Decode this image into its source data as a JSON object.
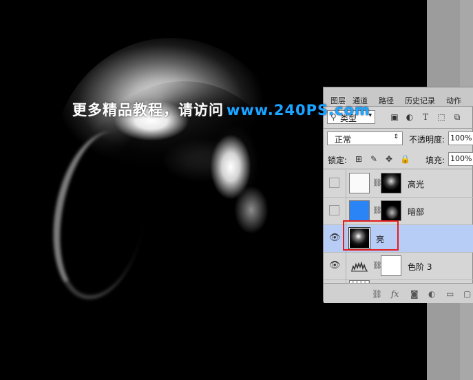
{
  "watermark": {
    "cn": "更多精品教程，请访问",
    "url": "www.240PS.com"
  },
  "panel": {
    "tabs": [
      {
        "label": "图层",
        "active": true
      },
      {
        "label": "通道",
        "active": false
      },
      {
        "label": "路径",
        "active": false
      },
      {
        "label": "历史记录",
        "active": false
      },
      {
        "label": "动作",
        "active": false
      }
    ],
    "filter": {
      "label": "类型",
      "icons": [
        "image-filter-icon",
        "adjustment-filter-icon",
        "type-filter-icon",
        "shape-filter-icon",
        "smart-object-filter-icon"
      ]
    },
    "blend_mode": "正常",
    "opacity_label": "不透明度:",
    "opacity_value": "100%",
    "lock_label": "锁定:",
    "fill_label": "填充:",
    "fill_value": "100%",
    "layers": [
      {
        "name": "高光",
        "visible": false,
        "selected": false
      },
      {
        "name": "暗部",
        "visible": false,
        "selected": false
      },
      {
        "name": "亮",
        "visible": true,
        "selected": true
      },
      {
        "name": "色阶 3",
        "visible": true,
        "selected": false
      }
    ],
    "bottom_icons": [
      "link-icon",
      "fx-icon",
      "mask-icon",
      "adjustment-icon",
      "folder-icon",
      "new-layer-icon"
    ],
    "fx_label": "fx"
  },
  "colors": {
    "selected_row": "#b8cdf6",
    "highlight_box": "#e31b1b",
    "watermark_url": "#1aa7ff",
    "blue_thumb": "#2a84f5"
  }
}
